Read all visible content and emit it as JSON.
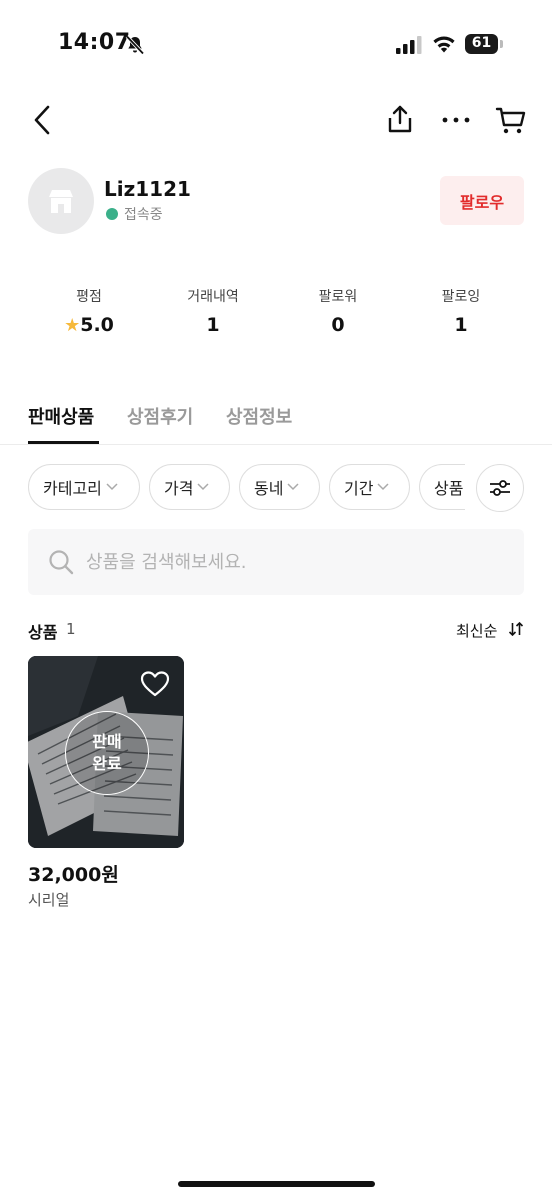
{
  "status_bar": {
    "time": "14:07",
    "battery": "61"
  },
  "profile": {
    "username": "Liz1121",
    "status": "접속중",
    "follow_label": "팔로우"
  },
  "stats": [
    {
      "label": "평점",
      "value": "5.0"
    },
    {
      "label": "거래내역",
      "value": "1"
    },
    {
      "label": "팔로워",
      "value": "0"
    },
    {
      "label": "팔로잉",
      "value": "1"
    }
  ],
  "tabs": [
    {
      "label": "판매상품",
      "active": true
    },
    {
      "label": "상점후기",
      "active": false
    },
    {
      "label": "상점정보",
      "active": false
    }
  ],
  "filters": [
    "카테고리",
    "가격",
    "동네",
    "기간",
    "상품"
  ],
  "search": {
    "placeholder": "상품을 검색해보세요."
  },
  "products_header": {
    "title": "상품",
    "count": "1",
    "sort_label": "최신순"
  },
  "products": [
    {
      "badge_line1": "판매",
      "badge_line2": "완료",
      "price": "32,000원",
      "name": "시리얼"
    }
  ],
  "colors": {
    "accent_red": "#e22c2c",
    "follow_bg": "#fdeeee",
    "online": "#3bb08a",
    "star": "#f6b93b"
  }
}
